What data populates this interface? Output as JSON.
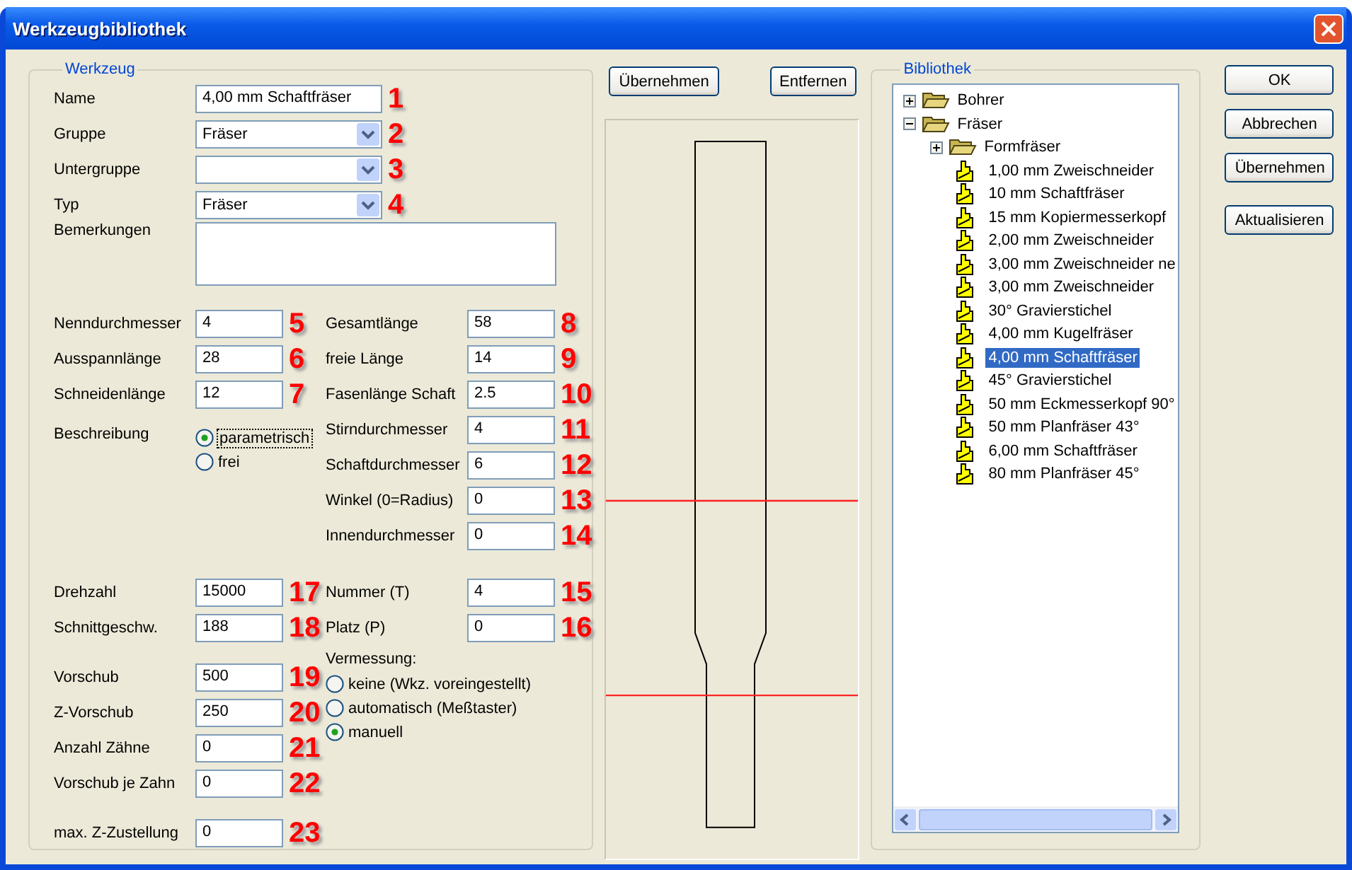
{
  "window": {
    "title": "Werkzeugbibliothek"
  },
  "tool_group": {
    "title": "Werkzeug",
    "top_fields": [
      {
        "kind": "text",
        "label": "Name",
        "value": "4,00 mm Schaftfräser",
        "marker": "1"
      },
      {
        "kind": "dropdown",
        "label": "Gruppe",
        "value": "Fräser",
        "marker": "2"
      },
      {
        "kind": "dropdown",
        "label": "Untergruppe",
        "marker": "3"
      },
      {
        "kind": "dropdown",
        "label": "Typ",
        "value": "Fräser",
        "marker": "4"
      },
      {
        "kind": "textarea",
        "label": "Bemerkungen"
      }
    ],
    "dimensions_left": [
      {
        "label": "Nenndurchmesser",
        "value": "4",
        "marker": "5"
      },
      {
        "label": "Ausspannlänge",
        "value": "28",
        "marker": "6"
      },
      {
        "label": "Schneidenlänge",
        "value": "12",
        "marker": "7"
      }
    ],
    "beschreibung": {
      "label": "Beschreibung",
      "options": [
        {
          "label": "parametrisch",
          "selected": true
        },
        {
          "label": "frei",
          "selected": false
        }
      ]
    },
    "dimensions_right": [
      {
        "label": "Gesamtlänge",
        "value": "58",
        "marker": "8"
      },
      {
        "label": "freie Länge",
        "value": "14",
        "marker": "9"
      },
      {
        "label": "Fasenlänge Schaft",
        "value": "2.5",
        "marker": "10"
      },
      {
        "label": "Stirndurchmesser",
        "value": "4",
        "marker": "11"
      },
      {
        "label": "Schaftdurchmesser",
        "value": "6",
        "marker": "12"
      },
      {
        "label": "Winkel (0=Radius)",
        "value": "0",
        "marker": "13"
      },
      {
        "label": "Innendurchmesser",
        "value": "0",
        "marker": "14"
      }
    ],
    "machining_left": [
      {
        "label": "Drehzahl",
        "value": "15000",
        "marker": "17"
      },
      {
        "label": "Schnittgeschw.",
        "value": "188",
        "marker": "18"
      }
    ],
    "machining_right": [
      {
        "label": "Nummer (T)",
        "value": "4",
        "marker": "15"
      },
      {
        "label": "Platz (P)",
        "value": "0",
        "marker": "16"
      }
    ],
    "feed_fields": [
      {
        "label": "Vorschub",
        "value": "500",
        "marker": "19"
      },
      {
        "label": "Z-Vorschub",
        "value": "250",
        "marker": "20"
      },
      {
        "label": "Anzahl Zähne",
        "value": "0",
        "marker": "21"
      },
      {
        "label": "Vorschub je Zahn",
        "value": "0",
        "marker": "22"
      },
      {
        "label": "max. Z-Zustellung",
        "value": "0",
        "marker": "23"
      }
    ],
    "vermessung": {
      "label": "Vermessung:",
      "options": [
        {
          "label": "keine (Wkz. voreingestellt)",
          "selected": false
        },
        {
          "label": "automatisch (Meßtaster)",
          "selected": false
        },
        {
          "label": "manuell",
          "selected": true
        }
      ]
    }
  },
  "top_buttons": [
    "Übernehmen",
    "Entfernen"
  ],
  "library": {
    "title": "Bibliothek",
    "tree": [
      {
        "kind": "folder",
        "label": "Bohrer",
        "expanded": false,
        "selected": false
      },
      {
        "kind": "folder",
        "label": "Fräser",
        "expanded": true,
        "selected": false,
        "children": [
          {
            "kind": "folder",
            "label": "Formfräser",
            "expanded": false,
            "selected": false
          },
          {
            "kind": "tool",
            "label": "1,00 mm Zweischneider",
            "selected": false
          },
          {
            "kind": "tool",
            "label": "10 mm Schaftfräser",
            "selected": false
          },
          {
            "kind": "tool",
            "label": "15 mm Kopiermesserkopf",
            "selected": false
          },
          {
            "kind": "tool",
            "label": "2,00 mm Zweischneider",
            "selected": false
          },
          {
            "kind": "tool",
            "label": "3,00 mm Zweischneider ne",
            "selected": false
          },
          {
            "kind": "tool",
            "label": "3,00 mm Zweischneider",
            "selected": false
          },
          {
            "kind": "tool",
            "label": "30° Gravierstichel",
            "selected": false
          },
          {
            "kind": "tool",
            "label": "4,00 mm Kugelfräser",
            "selected": false
          },
          {
            "kind": "tool",
            "label": "4,00 mm Schaftfräser",
            "selected": true
          },
          {
            "kind": "tool",
            "label": "45° Gravierstichel",
            "selected": false
          },
          {
            "kind": "tool",
            "label": "50 mm Eckmesserkopf 90°",
            "selected": false
          },
          {
            "kind": "tool",
            "label": "50 mm Planfräser 43°",
            "selected": false
          },
          {
            "kind": "tool",
            "label": "6,00 mm Schaftfräser",
            "selected": false
          },
          {
            "kind": "tool",
            "label": "80 mm Planfräser 45°",
            "selected": false
          }
        ]
      }
    ]
  },
  "dialog_buttons": [
    "OK",
    "Abbrechen",
    "Übernehmen",
    "Aktualisieren"
  ]
}
